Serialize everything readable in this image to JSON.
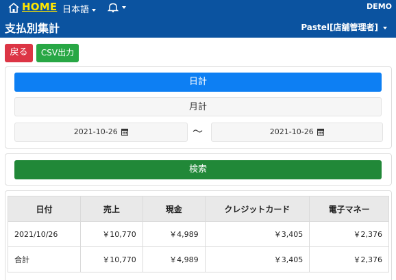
{
  "header": {
    "home_label": "HOME",
    "language_label": "日本語",
    "notification_icon": "bell-icon",
    "account_label": "DEMO",
    "page_title": "支払別集計",
    "user_label": "Pastel[店舗管理者]"
  },
  "colors": {
    "header_bg": "#0b53a0",
    "home_text": "#ffe600",
    "back_button": "#dc3545",
    "csv_button": "#28a745",
    "primary": "#0d7ff3",
    "search_button": "#218838"
  },
  "toolbar": {
    "back_label": "戻る",
    "csv_label": "CSV出力"
  },
  "period": {
    "daily_label": "日計",
    "monthly_label": "月計",
    "selected": "日計",
    "date_from": "2021-10-26",
    "date_to": "2021-10-26",
    "range_separator": "〜",
    "calendar_icon": "calendar-icon"
  },
  "search": {
    "label": "検索"
  },
  "table": {
    "columns": [
      "日付",
      "売上",
      "現金",
      "クレジットカード",
      "電子マネー"
    ],
    "rows": [
      [
        "2021/10/26",
        "￥10,770",
        "￥4,989",
        "￥3,405",
        "￥2,376"
      ],
      [
        "合計",
        "￥10,770",
        "￥4,989",
        "￥3,405",
        "￥2,376"
      ]
    ]
  }
}
